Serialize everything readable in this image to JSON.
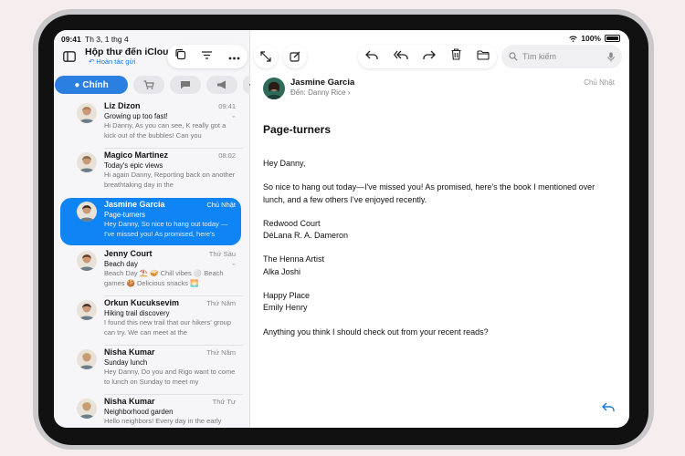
{
  "status": {
    "time": "09:41",
    "date": "Th 3, 1 thg 4",
    "battery": "100%",
    "battery_level": 1.0
  },
  "mailbox": {
    "title": "Hộp thư đến iCloud",
    "subtitle": "Hoàn tác gửi"
  },
  "tabs": {
    "primary": "Chính"
  },
  "messages": [
    {
      "sender": "Liz Dizon",
      "time": "09:41",
      "subject": "Growing up too fast!",
      "preview": "Hi Danny, As you can see, K really got a kick out of the bubbles! Can you",
      "attachment": true,
      "avatar_color": "#b07a55",
      "selected": false
    },
    {
      "sender": "Magico Martinez",
      "time": "08:02",
      "subject": "Today's epic views",
      "preview": "Hi again Danny, Reporting back on another breathtaking day in the",
      "attachment": false,
      "avatar_color": "#8a6a45",
      "selected": false
    },
    {
      "sender": "Jasmine Garcia",
      "time": "Chủ Nhật",
      "subject": "Page-turners",
      "preview": "Hey Danny, So nice to hang out today —I've missed you! As promised, here's",
      "attachment": false,
      "avatar_color": "#3b2a22",
      "selected": true
    },
    {
      "sender": "Jenny Court",
      "time": "Thứ Sáu",
      "subject": "Beach day",
      "preview": "Beach Day ⛱️ 🥪 Chill vibes ⚪ Beach games 🍪 Delicious snacks 🌅",
      "attachment": true,
      "avatar_color": "#6b3b2a",
      "selected": false
    },
    {
      "sender": "Orkun Kucuksevim",
      "time": "Thứ Năm",
      "subject": "Hiking trail discovery",
      "preview": "I found this new trail that our hikers' group can try. We can meet at the",
      "attachment": false,
      "avatar_color": "#4a2f22",
      "selected": false
    },
    {
      "sender": "Nisha Kumar",
      "time": "Thứ Năm",
      "subject": "Sunday lunch",
      "preview": "Hey Danny, Do you and Rigo want to come to lunch on Sunday to meet my",
      "attachment": false,
      "avatar_color": "#c8a36a",
      "selected": false
    },
    {
      "sender": "Nisha Kumar",
      "time": "Thứ Tư",
      "subject": "Neighborhood garden",
      "preview": "Hello neighbors! Every day in the early",
      "attachment": false,
      "avatar_color": "#c8a36a",
      "selected": false
    }
  ],
  "detail": {
    "sender": "Jasmine Garcia",
    "to_label": "Đến:",
    "to_name": "Danny Rice",
    "time": "Chủ Nhật",
    "subject": "Page-turners",
    "body": [
      "Hey Danny,",
      "So nice to hang out today—I've missed you! As promised, here's the book I mentioned over lunch, and a few others I've enjoyed recently.",
      "Redwood Court\nDéLana R. A. Dameron",
      "The Henna Artist\nAlka Joshi",
      "Happy Place\nEmily Henry",
      "Anything you think I should check out from your recent reads?"
    ]
  },
  "search": {
    "placeholder": "Tìm kiếm"
  },
  "icons": {
    "sidebar_toggle": "sidebar-icon",
    "copy": "duplicate-icon",
    "filter": "filter-icon",
    "more": "ellipsis-icon",
    "expand": "expand-icon",
    "compose": "compose-icon",
    "reply": "reply-icon",
    "reply_all": "reply-all-icon",
    "forward": "forward-icon",
    "trash": "trash-icon",
    "folder": "folder-icon",
    "search": "search-icon",
    "mic": "mic-icon"
  },
  "colors": {
    "accent": "#1977e8",
    "selected_row": "#0f84f4"
  }
}
